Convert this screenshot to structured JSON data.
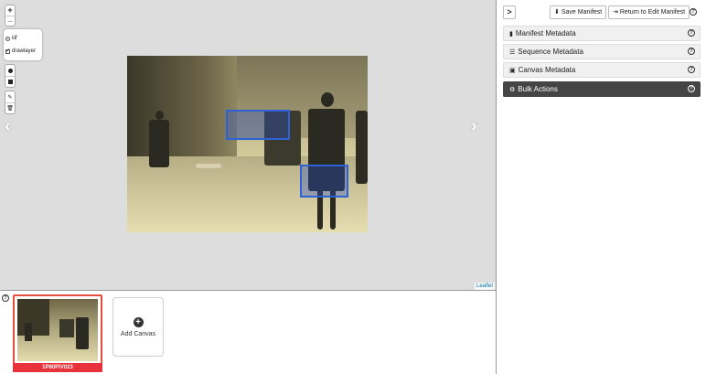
{
  "map": {
    "zoom_in": "+",
    "zoom_out": "–",
    "layers": [
      {
        "label": "iiif",
        "type": "radio"
      },
      {
        "label": "drawlayer",
        "type": "check"
      }
    ],
    "attribution": "Leaflet",
    "prev_arrow": "‹",
    "next_arrow": "›"
  },
  "strip": {
    "canvas_label": "1P80PIV023",
    "add_canvas": "Add Canvas",
    "add_icon": "+",
    "help": "?"
  },
  "panel": {
    "toggle": ">",
    "save_manifest": "Save Manifest",
    "return_edit": "Return to Edit Manifest",
    "help": "?",
    "sections": [
      {
        "label": "Manifest Metadata",
        "icon": "book-icon"
      },
      {
        "label": "Sequence Metadata",
        "icon": "list-icon"
      },
      {
        "label": "Canvas Metadata",
        "icon": "image-icon"
      },
      {
        "label": "Bulk Actions",
        "icon": "gears-icon"
      }
    ]
  },
  "colors": {
    "annotation": "#2d62d6",
    "selected_canvas": "#e8323c",
    "bulk_actions_bg": "#454545"
  }
}
